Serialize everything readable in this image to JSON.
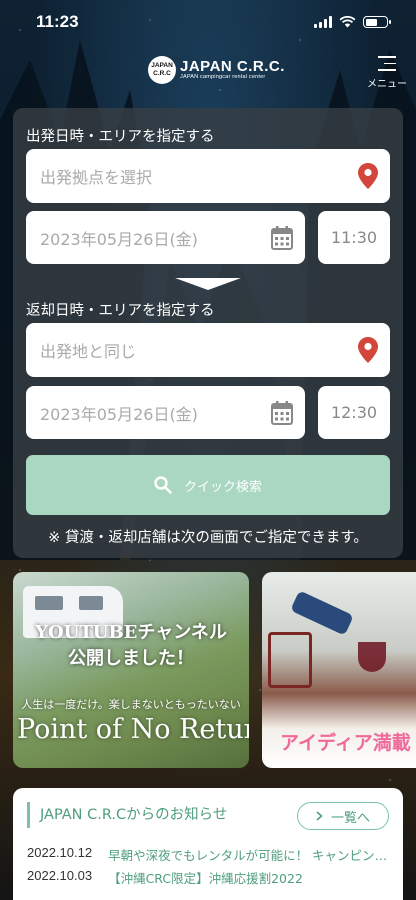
{
  "status_bar": {
    "time": "11:23"
  },
  "header": {
    "logo_badge": "JAPAN C.R.C",
    "logo_name": "JAPAN C.R.C.",
    "logo_sub": "JAPAN campingcar rental center",
    "menu_label": "メニュー"
  },
  "search": {
    "departure_title": "出発日時・エリアを指定する",
    "departure_location_placeholder": "出発拠点を選択",
    "departure_date": "2023年05月26日(金)",
    "departure_time": "11:30",
    "return_title": "返却日時・エリアを指定する",
    "return_location_placeholder": "出発地と同じ",
    "return_date": "2023年05月26日(金)",
    "return_time": "12:30",
    "search_button": "クイック検索",
    "note": "※ 貸渡・返却店舗は次の画面でご指定できます。"
  },
  "banners": [
    {
      "line1": "YOUTUBEチャンネル",
      "line2": "公開しました！",
      "subtitle": "人生は一度だけ。楽しまないともったいない",
      "title": "Point of No Return"
    },
    {
      "title": "アイディア満載"
    }
  ],
  "news": {
    "heading": "JAPAN C.R.Cからのお知らせ",
    "list_button": "一覧へ",
    "items": [
      {
        "date": "2022.10.12",
        "title": "早朝や深夜でもレンタルが可能に！ キャンピングカー"
      },
      {
        "date": "2022.10.03",
        "title": "【沖縄CRC限定】沖縄応援割2022"
      }
    ]
  },
  "colors": {
    "accent_green": "#4f9e7c",
    "search_button": "#a9d7c2",
    "pin_red": "#d2463c",
    "panel": "#373e44"
  }
}
